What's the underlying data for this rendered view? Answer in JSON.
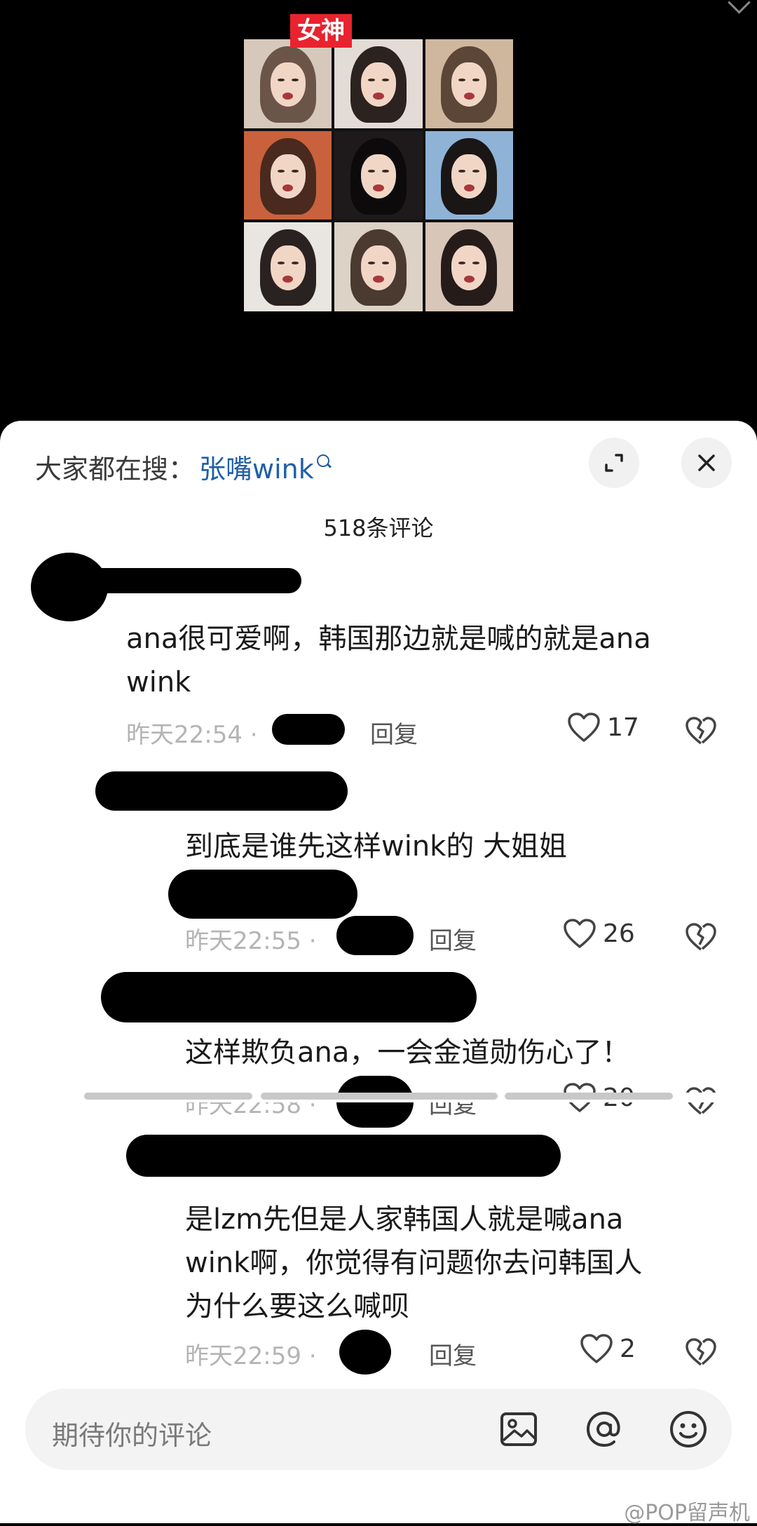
{
  "video": {
    "tag": "女神"
  },
  "sheet": {
    "search_hint_prefix": "大家都在搜：",
    "search_keyword": "张嘴wink",
    "comment_count": "518条评论"
  },
  "comments": [
    {
      "text_line1": "ana很可爱啊，韩国那边就是喊的就是ana",
      "text_line2": "wink",
      "time": "昨天22:54 ·",
      "reply": "回复",
      "likes": "17"
    },
    {
      "text_line1": "到底是谁先这样wink的 大姐姐",
      "time": "昨天22:55 ·",
      "reply": "回复",
      "likes": "26"
    },
    {
      "text_line1": "这样欺负ana，一会金道勋伤心了！",
      "time": "昨天22:58 ·",
      "reply": "回复",
      "likes": "20"
    },
    {
      "text_line1": "是lzm先但是人家韩国人就是喊ana",
      "text_line2": "wink啊，你觉得有问题你去问韩国人",
      "text_line3": "为什么要这么喊呗",
      "time": "昨天22:59 ·",
      "reply": "回复",
      "likes": "2"
    }
  ],
  "input": {
    "placeholder": "期待你的评论"
  },
  "icons": [
    "expand-icon",
    "close-icon",
    "search-icon",
    "heart-icon",
    "broken-heart-icon",
    "image-icon",
    "at-icon",
    "emoji-icon"
  ],
  "watermark": "@POP留声机"
}
